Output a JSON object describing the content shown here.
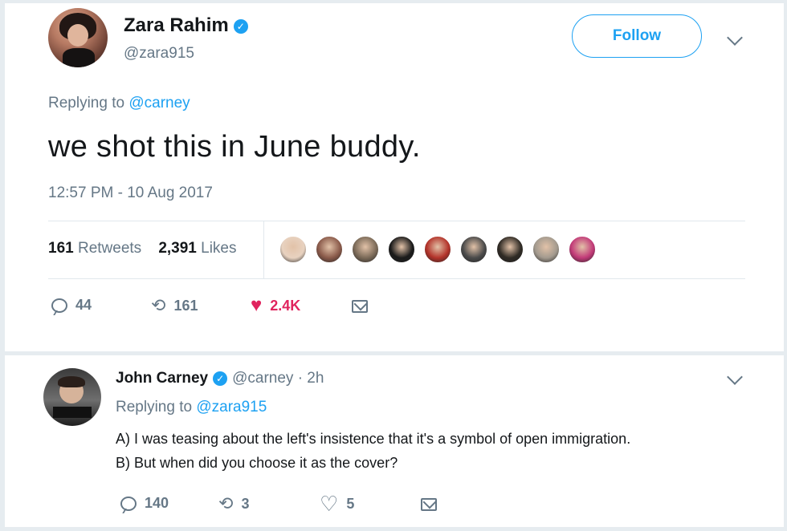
{
  "main_tweet": {
    "name": "Zara Rahim",
    "handle": "@zara915",
    "follow_label": "Follow",
    "replying_prefix": "Replying to",
    "replying_to": "@carney",
    "text": "we shot this in June buddy.",
    "timestamp": "12:57 PM - 10 Aug 2017",
    "retweets_count": "161",
    "retweets_label": "Retweets",
    "likes_count": "2,391",
    "likes_label": "Likes",
    "likers": [
      "#e8d2c0",
      "#8a5a4a",
      "#7b6a58",
      "#1a1a1a",
      "#b3332a",
      "#4a4a4a",
      "#2f2a24",
      "#a39a8e",
      "#c23a78"
    ],
    "actions": {
      "replies": "44",
      "retweets": "161",
      "likes": "2.4K"
    }
  },
  "reply_tweet": {
    "name": "John Carney",
    "handle_time": "@carney · 2h",
    "replying_prefix": "Replying to",
    "replying_to": "@zara915",
    "line1": "A) I was teasing about the left's insistence that it's a symbol of open immigration.",
    "line2": "B) But when did you choose it as the cover?",
    "actions": {
      "replies": "140",
      "retweets": "3",
      "likes": "5"
    }
  },
  "colors": {
    "accent": "#1da1f2",
    "like": "#e0245e",
    "muted": "#657786"
  }
}
